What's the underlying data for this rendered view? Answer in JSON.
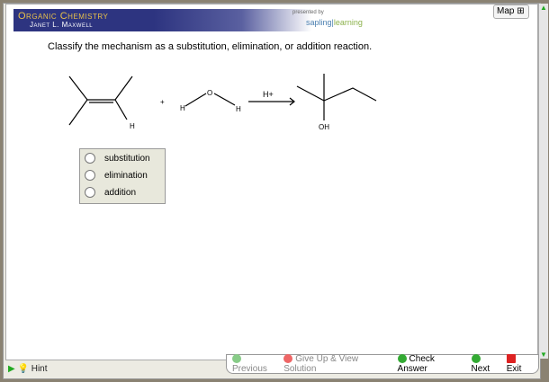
{
  "header": {
    "title": "Organic Chemistry",
    "author": "Janet L. Maxwell",
    "presented_by": "presented by",
    "sponsor_a": "sapling",
    "sponsor_b": "learning",
    "map_label": "Map"
  },
  "question": "Classify the mechanism as a substitution, elimination, or addition reaction.",
  "reaction": {
    "plus": "+",
    "h": "H",
    "o": "O",
    "catalyst": "H+",
    "oh": "OH"
  },
  "options": [
    "substitution",
    "elimination",
    "addition"
  ],
  "footer": {
    "hint": "Hint",
    "previous": "Previous",
    "give_up": "Give Up & View Solution",
    "check": "Check Answer",
    "next": "Next",
    "exit": "Exit"
  }
}
